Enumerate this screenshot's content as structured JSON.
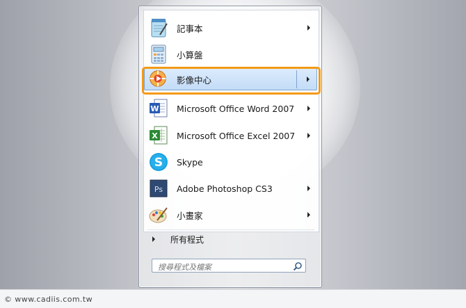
{
  "start_menu": {
    "items": [
      {
        "label": "記事本",
        "has_submenu": true,
        "icon": "notepad-icon"
      },
      {
        "label": "小算盤",
        "has_submenu": false,
        "icon": "calculator-icon"
      },
      {
        "label": "影像中心",
        "has_submenu": true,
        "icon": "media-center-icon",
        "highlighted": true
      },
      {
        "label": "Microsoft Office Word 2007",
        "has_submenu": true,
        "icon": "word-icon"
      },
      {
        "label": "Microsoft Office Excel 2007",
        "has_submenu": true,
        "icon": "excel-icon"
      },
      {
        "label": "Skype",
        "has_submenu": false,
        "icon": "skype-icon"
      },
      {
        "label": "Adobe Photoshop CS3",
        "has_submenu": true,
        "icon": "photoshop-icon"
      },
      {
        "label": "小畫家",
        "has_submenu": true,
        "icon": "paint-icon"
      }
    ],
    "all_programs": "所有程式",
    "search_placeholder": "搜尋程式及檔案",
    "icon_glyphs": {
      "word": "W",
      "excel": "X",
      "skype": "S",
      "photoshop": "Ps"
    }
  },
  "footer": {
    "text": "© www.cadiis.com.tw"
  },
  "colors": {
    "highlight_frame": "#f39a15",
    "selection": "#c3dcf7"
  }
}
